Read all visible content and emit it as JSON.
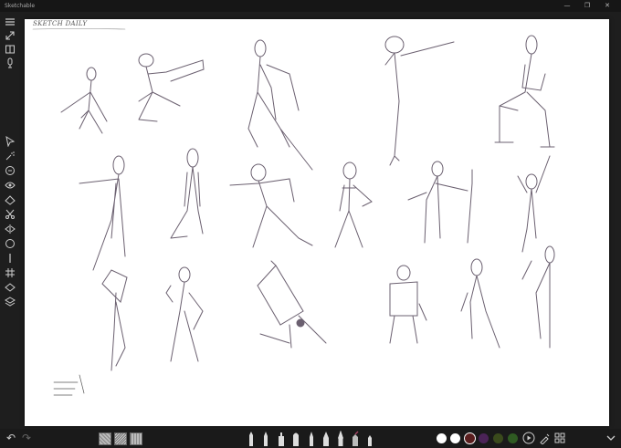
{
  "window": {
    "title": "Sketchable",
    "controls": [
      "—",
      "❐",
      "✕"
    ]
  },
  "sidebar": {
    "top_tools": [
      "menu-icon",
      "expand-icon",
      "book-icon",
      "microphone-icon"
    ],
    "tools": [
      "select-icon",
      "spray-icon",
      "rotate-icon",
      "eye-icon",
      "ruler-icon",
      "scissors-icon",
      "symmetry-icon",
      "circle-icon",
      "line-icon",
      "grid-icon",
      "layer-diamond-icon",
      "layers-icon"
    ]
  },
  "canvas": {
    "title": "SKETCH DAILY"
  },
  "bottom": {
    "undo": "↶",
    "redo": "↷",
    "textures": [
      "texture-dots",
      "texture-scribble",
      "texture-grid"
    ],
    "swatches": [
      "#ffffff",
      "#ffffff",
      "#5a1e1e",
      "#4b2357",
      "#3a4a1c",
      "#2f5a22"
    ],
    "buttons": [
      "play-icon",
      "eyedropper-icon",
      "grid-view-icon"
    ],
    "collapse": "chevron-down-icon"
  }
}
